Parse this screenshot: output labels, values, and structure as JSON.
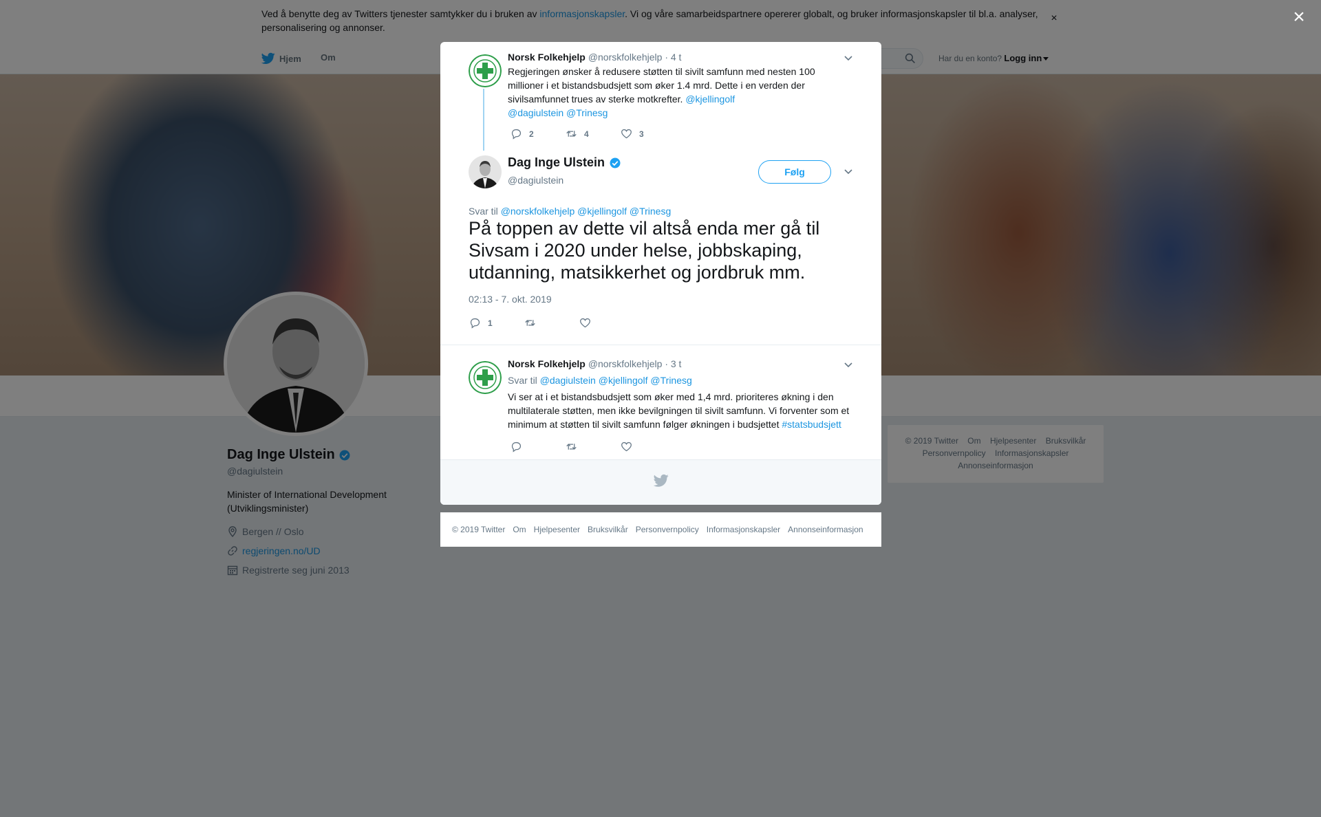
{
  "cookie_bar": {
    "text_before": "Ved å benytte deg av Twitters tjenester samtykker du i bruken av ",
    "link": "informasjonskapsler",
    "text_after": ". Vi og våre samarbeidspartnere opererer globalt, og bruker informasjonskapsler til bl.a. analyser, personalisering og annonser.",
    "close": "×"
  },
  "nav": {
    "home": "Hjem",
    "about": "Om",
    "account_prompt": "Har du en konto?",
    "login": "Logg inn"
  },
  "profile": {
    "name": "Dag Inge Ulstein",
    "handle": "@dagiulstein",
    "bio": "Minister of International Development (Utviklingsminister)",
    "location": "Bergen // Oslo",
    "url": "regjeringen.no/UD",
    "joined": "Registrerte seg juni 2013"
  },
  "side_footer": {
    "items": [
      "© 2019 Twitter",
      "Om",
      "Hjelpesenter",
      "Bruksvilkår",
      "Personvernpolicy",
      "Informasjonskapsler",
      "Annonseinformasjon"
    ]
  },
  "overlay_close": "×",
  "modal": {
    "parent_tweet": {
      "name": "Norsk Folkehjelp",
      "handle": "@norskfolkehjelp",
      "time": "· 4 t",
      "text": "Regjeringen ønsker å redusere støtten til sivilt samfunn med nesten 100 millioner i et bistandsbudsjett som øker 1.4 mrd. Dette i en verden der sivilsamfunnet trues av sterke motkrefter.",
      "mention1": "@kjellingolf",
      "mention2": "@dagiulstein",
      "mention3": "@Trinesg",
      "replies": "2",
      "retweets": "4",
      "likes": "3"
    },
    "main_tweet": {
      "name": "Dag Inge Ulstein",
      "handle": "@dagiulstein",
      "follow": "Følg",
      "reply_prefix": "Svar til",
      "reply_mentions": "@norskfolkehjelp @kjellingolf @Trinesg",
      "text": "På toppen av dette vil altså enda mer gå til Sivsam i 2020 under helse, jobbskaping, utdanning, matsikkerhet og jordbruk mm.",
      "timestamp": "02:13 - 7. okt. 2019",
      "replies": "1"
    },
    "reply_tweet": {
      "name": "Norsk Folkehjelp",
      "handle": "@norskfolkehjelp",
      "time": "· 3 t",
      "reply_prefix": "Svar til",
      "reply_mentions": "@dagiulstein @kjellingolf @Trinesg",
      "text": "Vi ser at i et bistandsbudsjett som øker med 1,4 mrd. prioriteres økning i den multilaterale støtten, men ikke bevilgningen til sivilt samfunn. Vi forventer som et minimum at støtten til sivilt samfunn følger økningen i budsjettet",
      "hashtag": "#statsbudsjett"
    }
  },
  "bottom_footer": {
    "items": [
      "© 2019 Twitter",
      "Om",
      "Hjelpesenter",
      "Bruksvilkår",
      "Personvernpolicy",
      "Informasjonskapsler",
      "Annonseinformasjon"
    ]
  },
  "colors": {
    "link": "#1b95e0",
    "twitter_blue": "#1da1f2",
    "folkehjelp_green": "#2e9e4a"
  },
  "icons": [
    "twitter-bird-icon",
    "search-icon",
    "chevron-down-icon",
    "reply-icon",
    "retweet-icon",
    "like-icon",
    "verified-icon",
    "location-icon",
    "link-icon",
    "calendar-icon",
    "close-icon"
  ]
}
